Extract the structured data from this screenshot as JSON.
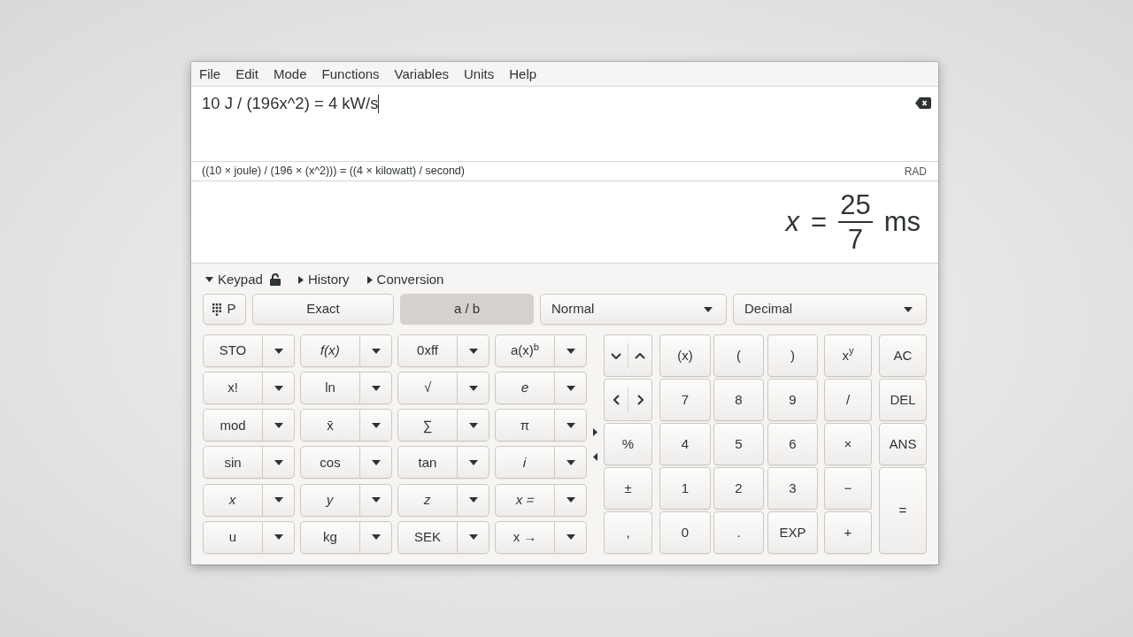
{
  "menu": [
    "File",
    "Edit",
    "Mode",
    "Functions",
    "Variables",
    "Units",
    "Help"
  ],
  "expression": {
    "value": "10 J / (196x^2) = 4 kW/s"
  },
  "parsed_expression": "((10 × joule) / (196 × (x^2))) = ((4 × kilowatt) / second)",
  "angle_unit": "RAD",
  "result": {
    "variable": "x",
    "operator": "=",
    "numerator": "25",
    "denominator": "7",
    "unit": "ms"
  },
  "sections": [
    {
      "label": "Keypad",
      "expanded": true
    },
    {
      "label": "History",
      "expanded": false
    },
    {
      "label": "Conversion",
      "expanded": false
    }
  ],
  "mode_bar": {
    "keypad_button": "P",
    "toggles": [
      {
        "label": "Exact",
        "selected": false
      },
      {
        "label": "a / b",
        "selected": true
      }
    ],
    "dropdowns": [
      {
        "value": "Normal"
      },
      {
        "value": "Decimal"
      }
    ]
  },
  "function_keys": [
    [
      {
        "label": "STO",
        "italic": false
      },
      {
        "label": "f(x)",
        "italic": true
      },
      {
        "label": "0xff",
        "italic": false
      },
      {
        "label": "a(x)$^{b}$",
        "italic": false
      }
    ],
    [
      {
        "label": "x!",
        "italic": false
      },
      {
        "label": "ln",
        "italic": false
      },
      {
        "label": "√",
        "italic": false
      },
      {
        "label": "e",
        "italic": true
      }
    ],
    [
      {
        "label": "mod",
        "italic": false
      },
      {
        "label": "x̄",
        "italic": false
      },
      {
        "label": "∑",
        "italic": false
      },
      {
        "label": "π",
        "italic": false
      }
    ],
    [
      {
        "label": "sin",
        "italic": false
      },
      {
        "label": "cos",
        "italic": false
      },
      {
        "label": "tan",
        "italic": false
      },
      {
        "label": "i",
        "italic": true
      }
    ],
    [
      {
        "label": "x",
        "italic": true
      },
      {
        "label": "y",
        "italic": true
      },
      {
        "label": "z",
        "italic": true
      },
      {
        "label": "x =",
        "italic": true
      }
    ],
    [
      {
        "label": "u",
        "italic": false
      },
      {
        "label": "kg",
        "italic": false
      },
      {
        "label": "SEK",
        "italic": false
      },
      {
        "label": "x →",
        "italic": false
      }
    ]
  ],
  "main_keys": [
    [
      {
        "kind": "arrows-vertical"
      },
      {
        "kind": "key",
        "label": "(x)"
      },
      {
        "kind": "key",
        "label": "("
      },
      {
        "kind": "key",
        "label": ")"
      },
      {
        "kind": "key",
        "label": "x$^{y}$"
      },
      {
        "kind": "key",
        "label": "AC"
      }
    ],
    [
      {
        "kind": "arrows-horizontal"
      },
      {
        "kind": "key",
        "label": "7"
      },
      {
        "kind": "key",
        "label": "8"
      },
      {
        "kind": "key",
        "label": "9"
      },
      {
        "kind": "key",
        "label": "/"
      },
      {
        "kind": "key",
        "label": "DEL"
      }
    ],
    [
      {
        "kind": "key",
        "label": "%"
      },
      {
        "kind": "key",
        "label": "4"
      },
      {
        "kind": "key",
        "label": "5"
      },
      {
        "kind": "key",
        "label": "6"
      },
      {
        "kind": "key",
        "label": "×"
      },
      {
        "kind": "key",
        "label": "ANS"
      }
    ],
    [
      {
        "kind": "key",
        "label": "±"
      },
      {
        "kind": "key",
        "label": "1"
      },
      {
        "kind": "key",
        "label": "2"
      },
      {
        "kind": "key",
        "label": "3"
      },
      {
        "kind": "key",
        "label": "−"
      },
      {
        "kind": "tall",
        "label": "="
      }
    ],
    [
      {
        "kind": "key",
        "label": ","
      },
      {
        "kind": "key",
        "label": "0"
      },
      {
        "kind": "key",
        "label": "."
      },
      {
        "kind": "key",
        "label": "EXP"
      },
      {
        "kind": "key",
        "label": "+"
      }
    ]
  ]
}
